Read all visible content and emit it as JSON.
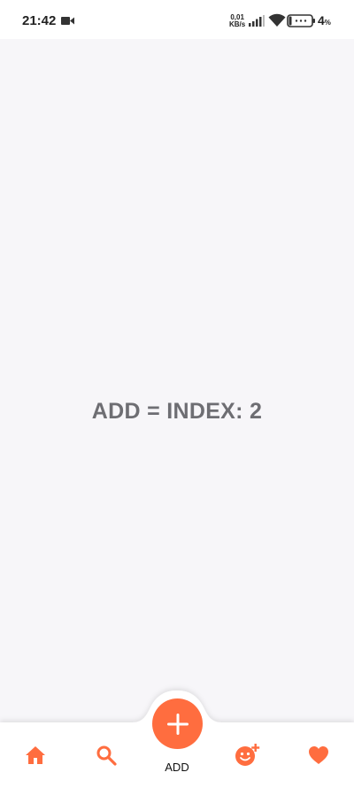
{
  "status_bar": {
    "time": "21:42",
    "net_speed_value": "0,01",
    "net_speed_unit": "KB/s",
    "battery_percent": "4",
    "battery_percent_sign": "%",
    "icons": [
      "video-camera-icon",
      "signal-icon",
      "wifi-icon",
      "battery-icon"
    ]
  },
  "main": {
    "text": "ADD = INDEX: 2"
  },
  "bottom_nav": {
    "accent_color": "#ff6d3f",
    "items": [
      {
        "icon": "home-icon"
      },
      {
        "icon": "search-icon"
      },
      {
        "icon": "plus-icon",
        "label": "ADD",
        "active": true
      },
      {
        "icon": "face-add-icon"
      },
      {
        "icon": "heart-icon"
      }
    ]
  }
}
